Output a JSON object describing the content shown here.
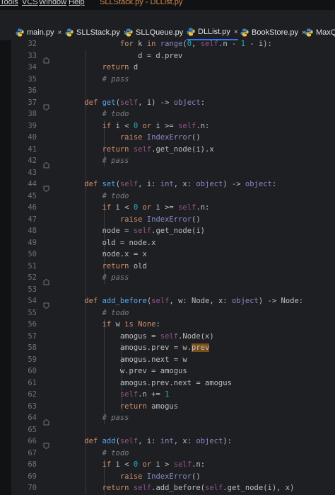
{
  "menubar": {
    "items": [
      "Tools",
      "VCS",
      "Window",
      "Help"
    ],
    "window_title": "SLLStack.py - DLList.py"
  },
  "tabs": [
    {
      "label": "main.py",
      "close": "×"
    },
    {
      "label": "SLLStack.py",
      "close": "×"
    },
    {
      "label": "SLLQueue.py",
      "close": "×"
    },
    {
      "label": "DLList.py",
      "close": "×",
      "active": true
    },
    {
      "label": "BookStore.py",
      "close": "×"
    },
    {
      "label": "MaxQue",
      "close": ""
    }
  ],
  "editor": {
    "lines": [
      {
        "n": "32",
        "code": [
          [
            "            ",
            "tx"
          ],
          [
            "for ",
            "kw"
          ],
          [
            "k ",
            "tx"
          ],
          [
            "in ",
            "kw"
          ],
          [
            "range",
            "bi"
          ],
          [
            "(",
            "tx"
          ],
          [
            "0",
            "num"
          ],
          [
            ", ",
            "tx"
          ],
          [
            "self",
            "sf"
          ],
          [
            ".n - ",
            "tx"
          ],
          [
            "1",
            "num"
          ],
          [
            " - i):",
            "tx"
          ]
        ]
      },
      {
        "n": "33",
        "code": [
          [
            "                d = d.prev",
            "tx"
          ]
        ]
      },
      {
        "n": "34",
        "code": [
          [
            "        ",
            "tx"
          ],
          [
            "return ",
            "kw"
          ],
          [
            "d",
            "tx"
          ]
        ]
      },
      {
        "n": "35",
        "code": [
          [
            "        ",
            "tx"
          ],
          [
            "# pass",
            "cm"
          ]
        ]
      },
      {
        "n": "36",
        "code": []
      },
      {
        "n": "37",
        "code": [
          [
            "    ",
            "tx"
          ],
          [
            "def ",
            "kw"
          ],
          [
            "get",
            "fn"
          ],
          [
            "(",
            "tx"
          ],
          [
            "self",
            "sf"
          ],
          [
            ", i) -> ",
            "tx"
          ],
          [
            "object",
            "bi"
          ],
          [
            ":",
            "tx"
          ]
        ]
      },
      {
        "n": "38",
        "code": [
          [
            "        ",
            "tx"
          ],
          [
            "# todo",
            "cm"
          ]
        ]
      },
      {
        "n": "39",
        "code": [
          [
            "        ",
            "tx"
          ],
          [
            "if ",
            "kw"
          ],
          [
            "i < ",
            "tx"
          ],
          [
            "0 ",
            "num"
          ],
          [
            "or ",
            "kw"
          ],
          [
            "i >= ",
            "tx"
          ],
          [
            "self",
            "sf"
          ],
          [
            ".n:",
            "tx"
          ]
        ]
      },
      {
        "n": "40",
        "code": [
          [
            "            ",
            "tx"
          ],
          [
            "raise ",
            "kw"
          ],
          [
            "IndexError",
            "bi"
          ],
          [
            "()",
            "tx"
          ]
        ]
      },
      {
        "n": "41",
        "code": [
          [
            "        ",
            "tx"
          ],
          [
            "return ",
            "kw"
          ],
          [
            "self",
            "sf"
          ],
          [
            ".get_node(i).x",
            "tx"
          ]
        ]
      },
      {
        "n": "42",
        "code": [
          [
            "        ",
            "tx"
          ],
          [
            "# pass",
            "cm"
          ]
        ]
      },
      {
        "n": "43",
        "code": []
      },
      {
        "n": "44",
        "code": [
          [
            "    ",
            "tx"
          ],
          [
            "def ",
            "kw"
          ],
          [
            "set",
            "fn"
          ],
          [
            "(",
            "tx"
          ],
          [
            "self",
            "sf"
          ],
          [
            ", i: ",
            "tx"
          ],
          [
            "int",
            "bi"
          ],
          [
            ", x: ",
            "tx"
          ],
          [
            "object",
            "bi"
          ],
          [
            ") -> ",
            "tx"
          ],
          [
            "object",
            "bi"
          ],
          [
            ":",
            "tx"
          ]
        ]
      },
      {
        "n": "45",
        "code": [
          [
            "        ",
            "tx"
          ],
          [
            "# todo",
            "cm"
          ]
        ]
      },
      {
        "n": "46",
        "code": [
          [
            "        ",
            "tx"
          ],
          [
            "if ",
            "kw"
          ],
          [
            "i < ",
            "tx"
          ],
          [
            "0 ",
            "num"
          ],
          [
            "or ",
            "kw"
          ],
          [
            "i >= ",
            "tx"
          ],
          [
            "self",
            "sf"
          ],
          [
            ".n:",
            "tx"
          ]
        ]
      },
      {
        "n": "47",
        "code": [
          [
            "            ",
            "tx"
          ],
          [
            "raise ",
            "kw"
          ],
          [
            "IndexError",
            "bi"
          ],
          [
            "()",
            "tx"
          ]
        ]
      },
      {
        "n": "48",
        "code": [
          [
            "        node = ",
            "tx"
          ],
          [
            "self",
            "sf"
          ],
          [
            ".get_node(i)",
            "tx"
          ]
        ]
      },
      {
        "n": "49",
        "code": [
          [
            "        old = node.x",
            "tx"
          ]
        ]
      },
      {
        "n": "50",
        "code": [
          [
            "        node.x = x",
            "tx"
          ]
        ]
      },
      {
        "n": "51",
        "code": [
          [
            "        ",
            "tx"
          ],
          [
            "return ",
            "kw"
          ],
          [
            "old",
            "tx"
          ]
        ]
      },
      {
        "n": "52",
        "code": [
          [
            "        ",
            "tx"
          ],
          [
            "# pass",
            "cm"
          ]
        ]
      },
      {
        "n": "53",
        "code": []
      },
      {
        "n": "54",
        "code": [
          [
            "    ",
            "tx"
          ],
          [
            "def ",
            "kw"
          ],
          [
            "add_before",
            "fn"
          ],
          [
            "(",
            "tx"
          ],
          [
            "self",
            "sf"
          ],
          [
            ", w: Node, x: ",
            "tx"
          ],
          [
            "object",
            "bi"
          ],
          [
            ") -> Node:",
            "tx"
          ]
        ]
      },
      {
        "n": "55",
        "code": [
          [
            "        ",
            "tx"
          ],
          [
            "# todo",
            "cm"
          ]
        ]
      },
      {
        "n": "56",
        "code": [
          [
            "        ",
            "tx"
          ],
          [
            "if ",
            "kw"
          ],
          [
            "w ",
            "tx"
          ],
          [
            "is ",
            "kw"
          ],
          [
            "None",
            "kw"
          ],
          [
            ":",
            "tx"
          ]
        ]
      },
      {
        "n": "57",
        "code": [
          [
            "            amogus = ",
            "tx"
          ],
          [
            "self",
            "sf"
          ],
          [
            ".Node(x)",
            "tx"
          ]
        ]
      },
      {
        "n": "58",
        "code": [
          [
            "            amogus.prev = w.",
            "tx"
          ],
          [
            "prev",
            "hl"
          ]
        ]
      },
      {
        "n": "59",
        "code": [
          [
            "            amogus.next = w",
            "tx"
          ]
        ]
      },
      {
        "n": "60",
        "code": [
          [
            "            w.prev = amogus",
            "tx"
          ]
        ]
      },
      {
        "n": "61",
        "code": [
          [
            "            amogus.prev.next = amogus",
            "tx"
          ]
        ]
      },
      {
        "n": "62",
        "code": [
          [
            "            ",
            "tx"
          ],
          [
            "self",
            "sf"
          ],
          [
            ".n += ",
            "tx"
          ],
          [
            "1",
            "num"
          ]
        ]
      },
      {
        "n": "63",
        "code": [
          [
            "            ",
            "tx"
          ],
          [
            "return ",
            "kw"
          ],
          [
            "amogus",
            "tx"
          ]
        ]
      },
      {
        "n": "64",
        "code": [
          [
            "        ",
            "tx"
          ],
          [
            "# pass",
            "cm"
          ]
        ]
      },
      {
        "n": "65",
        "code": []
      },
      {
        "n": "66",
        "code": [
          [
            "    ",
            "tx"
          ],
          [
            "def ",
            "kw"
          ],
          [
            "add",
            "fn"
          ],
          [
            "(",
            "tx"
          ],
          [
            "self",
            "sf"
          ],
          [
            ", i: ",
            "tx"
          ],
          [
            "int",
            "bi"
          ],
          [
            ", x: ",
            "tx"
          ],
          [
            "object",
            "bi"
          ],
          [
            "):",
            "tx"
          ]
        ]
      },
      {
        "n": "67",
        "code": [
          [
            "        ",
            "tx"
          ],
          [
            "# todo",
            "cm"
          ]
        ]
      },
      {
        "n": "68",
        "code": [
          [
            "        ",
            "tx"
          ],
          [
            "if ",
            "kw"
          ],
          [
            "i < ",
            "tx"
          ],
          [
            "0 ",
            "num"
          ],
          [
            "or ",
            "kw"
          ],
          [
            "i > ",
            "tx"
          ],
          [
            "self",
            "sf"
          ],
          [
            ".n:",
            "tx"
          ]
        ]
      },
      {
        "n": "69",
        "code": [
          [
            "            ",
            "tx"
          ],
          [
            "raise ",
            "kw"
          ],
          [
            "IndexError",
            "bi"
          ],
          [
            "()",
            "tx"
          ]
        ]
      },
      {
        "n": "70",
        "code": [
          [
            "        ",
            "tx"
          ],
          [
            "return ",
            "kw"
          ],
          [
            "self",
            "sf"
          ],
          [
            ".add_before(",
            "tx"
          ],
          [
            "self",
            "sf"
          ],
          [
            ".get_node(i), x)",
            "tx"
          ]
        ]
      }
    ]
  },
  "colors": {
    "background": "#1e1f22",
    "keyword": "#cf8e6d",
    "function": "#56a8f5",
    "self": "#94558d",
    "number": "#2aacb8",
    "comment": "#7a7e85",
    "builtin": "#8888c6",
    "highlight": "#7a4e17",
    "tab_active_underline": "#3574f0"
  }
}
